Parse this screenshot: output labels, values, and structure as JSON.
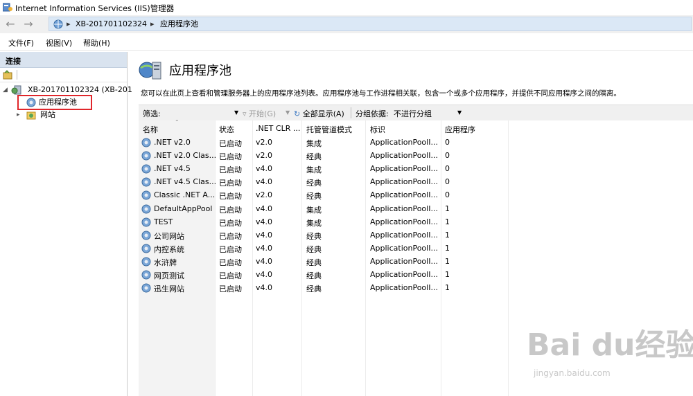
{
  "window": {
    "title": "Internet Information Services (IIS)管理器"
  },
  "address": {
    "crumbs": [
      "XB-201701102324",
      "应用程序池"
    ]
  },
  "menu": [
    "文件(F)",
    "视图(V)",
    "帮助(H)"
  ],
  "connections": {
    "header": "连接",
    "server": "XB-201701102324 (XB-201",
    "app_pools": "应用程序池",
    "sites": "网站"
  },
  "page": {
    "title": "应用程序池",
    "description": "您可以在此页上查看和管理服务器上的应用程序池列表。应用程序池与工作进程相关联，包含一个或多个应用程序，并提供不同应用程序之间的隔离。"
  },
  "filterbar": {
    "filter_label": "筛选:",
    "start_label": "开始(G)",
    "show_all_label": "全部显示(A)",
    "group_by_label": "分组依据:",
    "group_by_value": "不进行分组"
  },
  "table": {
    "columns": [
      "名称",
      "状态",
      ".NET CLR ...",
      "托管管道模式",
      "标识",
      "应用程序"
    ],
    "rows": [
      [
        ".NET v2.0",
        "已启动",
        "v2.0",
        "集成",
        "ApplicationPoolI...",
        "0"
      ],
      [
        ".NET v2.0 Clas...",
        "已启动",
        "v2.0",
        "经典",
        "ApplicationPoolI...",
        "0"
      ],
      [
        ".NET v4.5",
        "已启动",
        "v4.0",
        "集成",
        "ApplicationPoolI...",
        "0"
      ],
      [
        ".NET v4.5 Clas...",
        "已启动",
        "v4.0",
        "经典",
        "ApplicationPoolI...",
        "0"
      ],
      [
        "Classic .NET A...",
        "已启动",
        "v2.0",
        "经典",
        "ApplicationPoolI...",
        "0"
      ],
      [
        "DefaultAppPool",
        "已启动",
        "v4.0",
        "集成",
        "ApplicationPoolI...",
        "1"
      ],
      [
        "TEST",
        "已启动",
        "v4.0",
        "集成",
        "ApplicationPoolI...",
        "1"
      ],
      [
        "公司网站",
        "已启动",
        "v4.0",
        "经典",
        "ApplicationPoolI...",
        "1"
      ],
      [
        "内控系统",
        "已启动",
        "v4.0",
        "经典",
        "ApplicationPoolI...",
        "1"
      ],
      [
        "水浒牌",
        "已启动",
        "v4.0",
        "经典",
        "ApplicationPoolI...",
        "1"
      ],
      [
        "网页测试",
        "已启动",
        "v4.0",
        "经典",
        "ApplicationPoolI...",
        "1"
      ],
      [
        "迅生网站",
        "已启动",
        "v4.0",
        "经典",
        "ApplicationPoolI...",
        "1"
      ]
    ]
  },
  "watermark": {
    "brand": "Bai du经验",
    "url": "jingyan.baidu.com"
  }
}
